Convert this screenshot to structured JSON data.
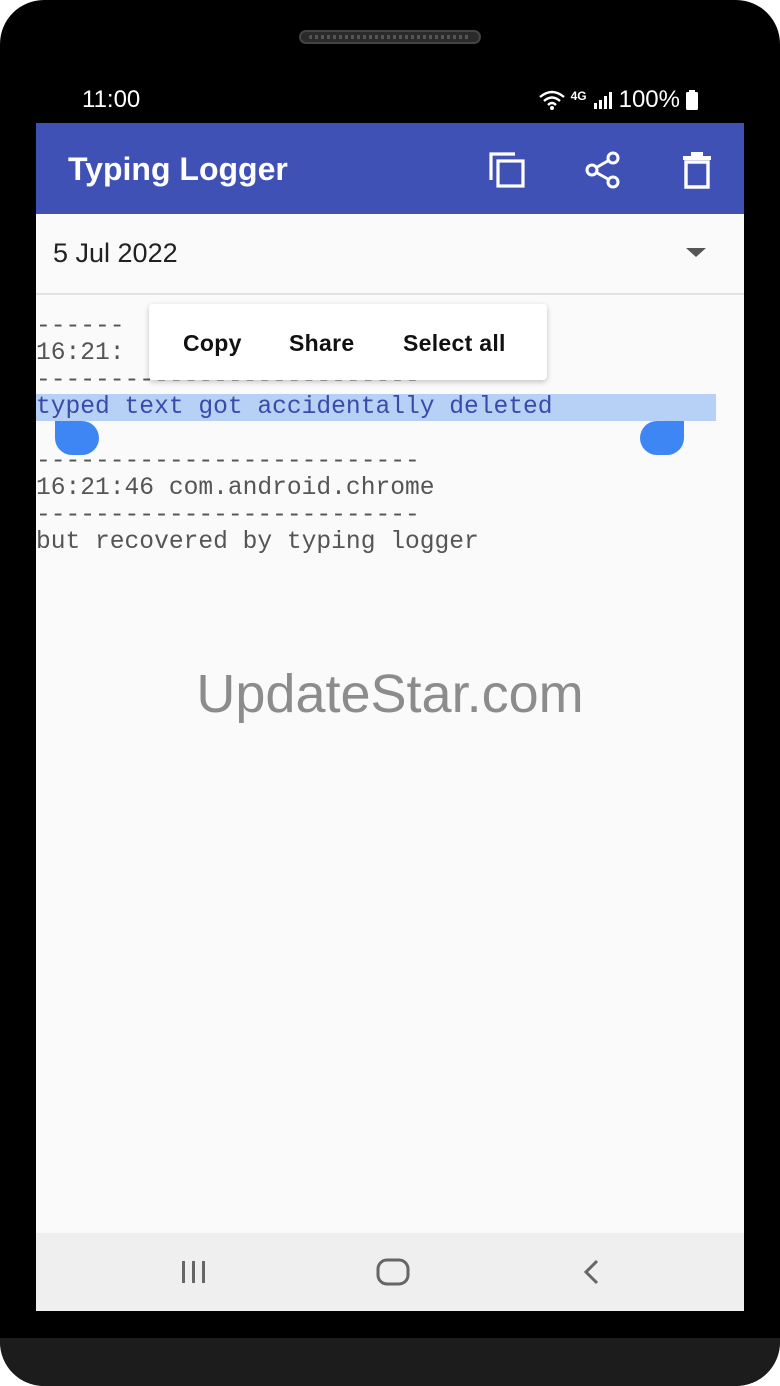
{
  "status_bar": {
    "time": "11:00",
    "network": "4G",
    "battery": "100%",
    "icons": [
      "wifi-icon",
      "signal-icon",
      "battery-icon"
    ]
  },
  "app_bar": {
    "title": "Typing Logger",
    "actions": [
      "copy-icon",
      "share-icon",
      "delete-icon"
    ],
    "color": "#3f51b5"
  },
  "date_selector": {
    "value": "5 Jul 2022"
  },
  "context_menu": {
    "copy": "Copy",
    "share": "Share",
    "select_all": "Select all"
  },
  "log": {
    "lines": [
      "------",
      "16:21:",
      "--------------------------",
      "typed text got accidentally deleted",
      "--------------------------",
      "16:21:46 com.android.chrome",
      "--------------------------",
      "but recovered by typing logger"
    ],
    "selection_color": "#b7d0f5",
    "handle_color": "#3f86f5"
  },
  "watermark": "UpdateStar.com",
  "nav_bar": {
    "buttons": [
      "recents-icon",
      "home-icon",
      "back-icon"
    ]
  }
}
